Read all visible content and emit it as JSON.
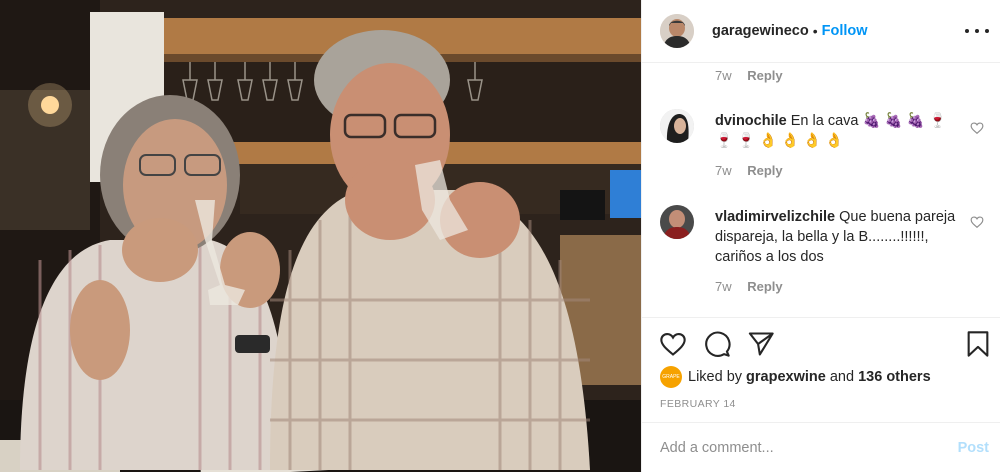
{
  "post": {
    "username": "garagewineco",
    "separator": "•",
    "follow_label": "Follow"
  },
  "comments": {
    "top_meta": {
      "time": "7w",
      "reply": "Reply"
    },
    "items": [
      {
        "username": "dvinochile",
        "text": "En la cava",
        "emoji_line1": "🍇 🍇 🍇 🍷",
        "emoji_line2": "🍷 🍷 👌 👌 👌 👌",
        "time": "7w",
        "reply": "Reply"
      },
      {
        "username": "vladimirvelizchile",
        "text": "Que buena pareja dispareja, la bella y la B........!!!!!!, cariños a los dos",
        "time": "7w",
        "reply": "Reply"
      }
    ]
  },
  "likes": {
    "prefix": "Liked by",
    "user": "grapexwine",
    "and": "and",
    "others": "136 others",
    "avatar_text": "GRAPE"
  },
  "date": "FEBRUARY 14",
  "add_comment": {
    "placeholder": "Add a comment...",
    "post_label": "Post"
  },
  "colors": {
    "follow_blue": "#0095f6",
    "post_disabled": "#b2dffc",
    "muted_text": "#8e8e8e",
    "divider": "#efefef"
  },
  "icons": [
    "heart-icon",
    "comment-icon",
    "share-icon",
    "bookmark-icon",
    "more-icon",
    "small-heart-icon"
  ]
}
